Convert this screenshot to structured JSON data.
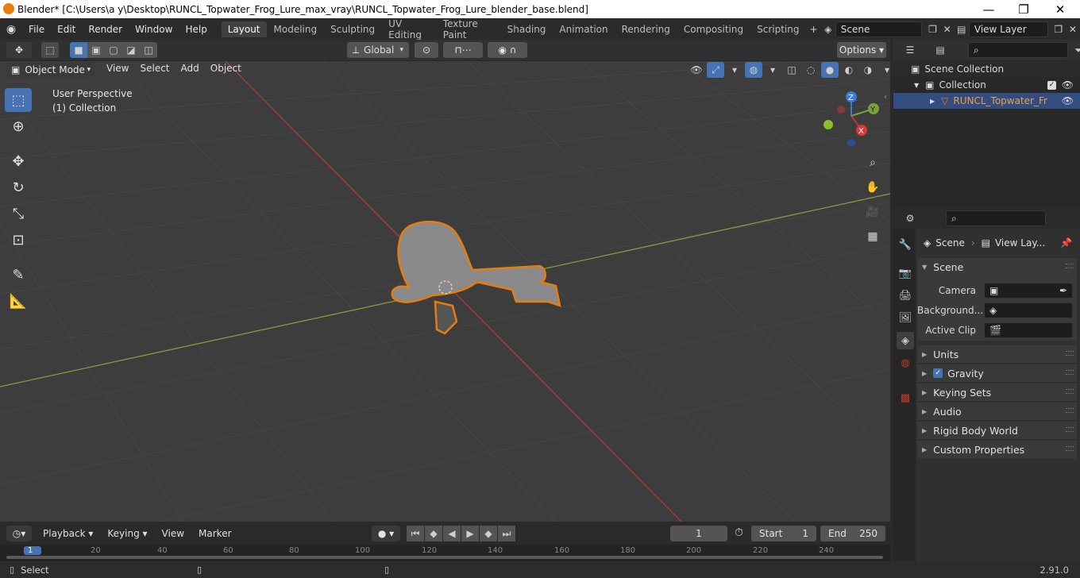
{
  "window": {
    "title": "Blender* [C:\\Users\\a y\\Desktop\\RUNCL_Topwater_Frog_Lure_max_vray\\RUNCL_Topwater_Frog_Lure_blender_base.blend]",
    "minimize": "—",
    "maximize": "❐",
    "close": "✕"
  },
  "menus": [
    "File",
    "Edit",
    "Render",
    "Window",
    "Help"
  ],
  "workspaces": [
    "Layout",
    "Modeling",
    "Sculpting",
    "UV Editing",
    "Texture Paint",
    "Shading",
    "Animation",
    "Rendering",
    "Compositing",
    "Scripting"
  ],
  "scene_field": "Scene",
  "view_layer_field": "View Layer",
  "viewport": {
    "transform": "Global",
    "options": "Options",
    "mode": "Object Mode",
    "header_menus": [
      "View",
      "Select",
      "Add",
      "Object"
    ],
    "overlay_text_1": "User Perspective",
    "overlay_text_2": "(1) Collection",
    "gizmo": {
      "x": "X",
      "y": "Y",
      "z": "Z"
    }
  },
  "outliner": {
    "scene_collection": "Scene Collection",
    "collection": "Collection",
    "object": "RUNCL_Topwater_Fr"
  },
  "properties": {
    "breadcrumb_scene": "Scene",
    "breadcrumb_layer": "View Lay...",
    "scene_panel": "Scene",
    "fields": [
      {
        "label": "Camera"
      },
      {
        "label": "Background..."
      },
      {
        "label": "Active Clip"
      }
    ],
    "panels": [
      "Units",
      "Gravity",
      "Keying Sets",
      "Audio",
      "Rigid Body World",
      "Custom Properties"
    ]
  },
  "timeline": {
    "menus": [
      "Playback",
      "Keying",
      "View",
      "Marker"
    ],
    "current_frame": "1",
    "start_label": "Start",
    "start": "1",
    "end_label": "End",
    "end": "250",
    "ruler": [
      "1",
      "20",
      "40",
      "60",
      "80",
      "100",
      "120",
      "140",
      "160",
      "180",
      "200",
      "220",
      "240"
    ]
  },
  "status": {
    "left": "Select",
    "version": "2.91.0"
  },
  "colors": {
    "accent": "#4772b3",
    "selection": "#e87d0d",
    "x_axis": "#b03a3a",
    "y_axis": "#7da03a"
  }
}
